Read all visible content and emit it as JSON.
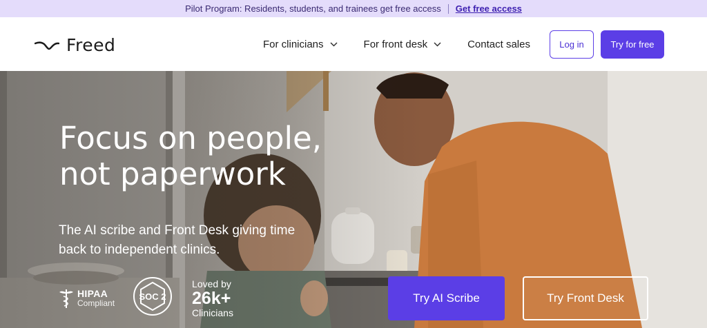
{
  "banner": {
    "text": "Pilot Program: Residents, students, and trainees get free access",
    "link": "Get free access"
  },
  "header": {
    "brand": "Freed",
    "nav": [
      {
        "label": "For clinicians",
        "has_dropdown": true
      },
      {
        "label": "For front desk",
        "has_dropdown": true
      },
      {
        "label": "Contact sales",
        "has_dropdown": false
      }
    ],
    "login_label": "Log in",
    "try_label": "Try for free"
  },
  "hero": {
    "headline_line1": "Focus on people,",
    "headline_line2": "not paperwork",
    "subline": "The AI scribe and Front Desk giving time back to independent clinics.",
    "hipaa_title": "HIPAA",
    "hipaa_sub": "Compliant",
    "soc_label": "SOC 2",
    "loved_top": "Loved by",
    "loved_count": "26k+",
    "loved_bottom": "Clinicians",
    "cta_primary": "Try AI Scribe",
    "cta_secondary": "Try Front Desk"
  },
  "colors": {
    "accent": "#5b3ee6",
    "banner_bg": "#e4dcfb"
  }
}
